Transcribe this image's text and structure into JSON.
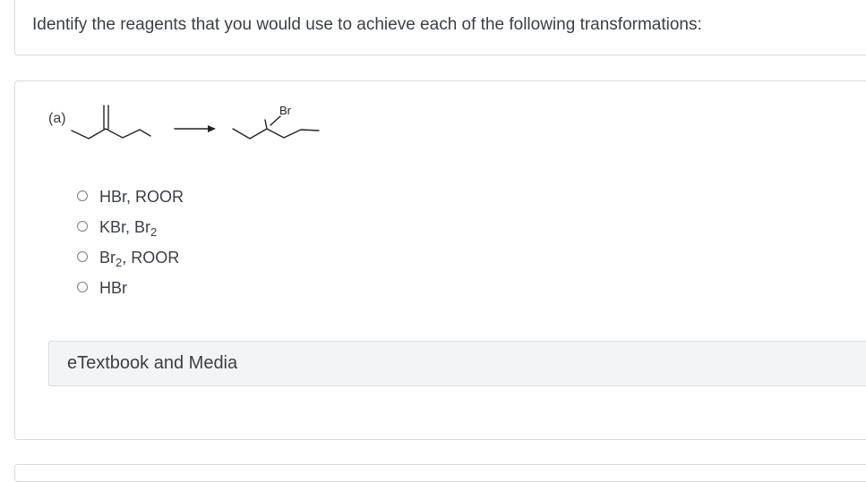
{
  "prompt": "Identify the reagents that you would use to achieve each of the following transformations:",
  "part_label": "(a)",
  "reaction": {
    "product_substituent": "Br"
  },
  "options": [
    {
      "main": "HBr, ROOR",
      "sub": "",
      "rest": ""
    },
    {
      "main": "KBr, Br",
      "sub": "2",
      "rest": ""
    },
    {
      "main": "Br",
      "sub": "2",
      "rest": ", ROOR"
    },
    {
      "main": "HBr",
      "sub": "",
      "rest": ""
    }
  ],
  "media_label": "eTextbook and Media"
}
